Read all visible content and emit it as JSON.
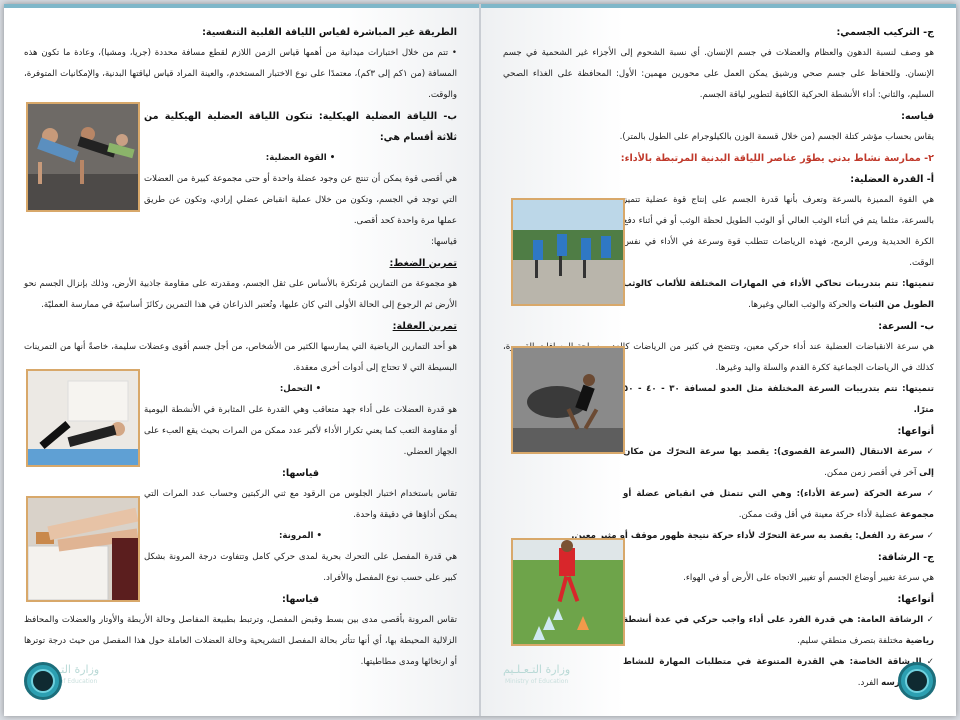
{
  "right_page": {
    "c_heading": "ج- التركيب الجسمي:",
    "c_p1": "هو وصف لنسبة الدهون والعظام والعضلات في جسم الإنسان. أي نسبة الشحوم إلى الأجزاء غير الشحمية في جسم الإنسان.",
    "c_p2": "وللحفاظ على جسم صحي ورشيق يمكن العمل على محورين مهمين: الأول: المحافظة على الغذاء الصحي السليم، والثاني: أداء",
    "c_p3": "الأنشطة الحركية الكافية لتطوير لياقة الجسم.",
    "measure_heading": "قياسه:",
    "measure_p": "يقاس بحساب مؤشر كتلة الجسم (من خلال قسمة الوزن بالكيلوجرام على الطول بالمتر).",
    "section2_heading": "٢- ممارسة نشاط بدني يطوّر عناصر اللياقة البدنية المرتبطة بالأداء:",
    "agility_power_heading": "أ- القدرة العضلية:",
    "power_p1": "هي القوة المميزة بالسرعة وتعرف بأنها قدرة الجسم على إنتاج قوة عضلية تتميز بالسرعة،",
    "power_p2": "مثلما يتم في أثناء الوثب العالي أو الوثب الطويل لحظة الوثب أو في أثناء دفع الكرة الحديدية",
    "power_p3": "ورمي الرمح، فهذه الرياضات تتطلب قوة وسرعة في الأداء في نفس الوقت.",
    "power_dev": "تنميتها: تتم بتدريبات تحاكي الأداء في المهارات المختلفة للألعاب كالوثب الطويل من الثبات",
    "power_dev2": "والحركة والوثب العالي وغيرها.",
    "speed_heading": "ب- السرعة:",
    "speed_p1": "هي سرعة الانقباضات العضلية عند أداء حركي معين، وتتضح في كثير من الرياضات كالعدو",
    "speed_p2": "وسباحة المسافات القصيرة، كذلك في الرياضات الجماعية ككرة القدم والسلة واليد وغيرها.",
    "speed_dev": "تنميتها: تتم بتدريبات السرعة المختلفة مثل العدو لمسافة ٣٠ - ٤٠ - ٥٠ مترًا.",
    "types_heading": "أنواعها:",
    "speed_t1a": "✓ سرعة الانتقال (السرعة القصوى): يقصد بها سرعة التحرّك من مكان إلى",
    "speed_t1b": "آخر في أقصر زمن ممكن.",
    "speed_t2a": "✓ سرعة الحركة (سرعة الأداء): وهي التي تتمثل في انقباض عضلة أو مجموعة",
    "speed_t2b": "عضلية لأداء حركة معينة في أقل وقت ممكن.",
    "speed_t3": "✓ سرعة رد الفعل: يقصد به سرعة التحرّك لأداء حركة نتيجة ظهور موقف أو مثير معين.",
    "agility_heading": "ج- الرشاقة:",
    "agility_p": "هي سرعة تغيير أوضاع الجسم أو تغيير الاتجاه على الأرض أو في الهواء.",
    "agility_types": "أنواعها:",
    "agility_t1a": "✓ الرشاقة العامة: هي قدرة الفرد على أداء واجب حركي في عدة أنشطة رياضية",
    "agility_t1b": "مختلفة بتصرف منطقي سليم.",
    "agility_t2a": "✓ الرشاقة الخاصة: هي القدرة المتنوعة في متطلبات المهارة للنشاط الذي يمارسه",
    "agility_t2b": "الفرد.",
    "watermark": "وزارة التـعـلـيم",
    "watermark_small": "Ministry of Education"
  },
  "left_page": {
    "indirect_heading": "الطريقة غير المباشرة لقياس اللياقة القلبية التنفسية:",
    "indirect_p1": "• تتم من خلال اختبارات ميدانية من أهمها قياس الزمن اللازم لقطع مسافة محددة (جريا، ومشيا)، وعادة ما تكون",
    "indirect_p2": "هذه المسافة (من ١كم إلى ٣كم)، معتمدًا على نوع الاختبار المستخدم، والعينة المراد قياس لياقتها البدنية، والإمكانيات",
    "indirect_p3": "المتوفرة، والوقت.",
    "structural_heading": "ب- اللياقة العضلية الهيكلية: تتكون اللياقة العضلية الهيكلية من ثلاثة أقسام هي:",
    "strength_bullet": "• القوة العضلية:",
    "strength_p1": "هي أقصى قوة يمكن أن تنتج عن وجود عضلة واحدة أو حتى مجموعة كبيرة من العضلات",
    "strength_p2": "التي توجد في الجسم، وتكون من خلال عملية انقباض عضلي إرادي، وتكون عن طريق عملها",
    "strength_p3": "مرة واحدة كحد أقصى.",
    "strength_measure": "قياسها:",
    "pushup_heading": "تمرين الضغط:",
    "pushup_p1": "هو مجموعة من التمارين مُرتكزة بالأساس على ثقل الجسم، ومقدرته على مقاومة جاذبية الأرض، وذلك بإنزال الجسم نحو",
    "pushup_p2": "الأرض ثم الرجوع إلى الحالة الأولى التي كان عليها، وتُعتبر الذراعان في هذا التمرين ركائزَ أساسيّة في ممارسة العمليّة.",
    "pullup_heading": "تمرين العقلة:",
    "pullup_p1": "هو أحد التمارين الرياضية التي يمارسها الكثير من الأشخاص، من أجل جسم أقوى وعضلات سليمة، خاصةً أنها من التمرينات",
    "pullup_p2": "البسيطة التي لا تحتاج إلى أدوات أخرى معقدة.",
    "endurance_bullet": "• التحمل:",
    "endurance_p1": "هو قدرة العضلات على أداء جهد متعاقب وهي القدرة على المثابرة في الأنشطة اليومية",
    "endurance_p2": "أو مقاومة التعب كما يعني تكرار الأداء لأكبر عدد ممكن من المرات بحيث يقع العبء على",
    "endurance_p3": "الجهاز العضلي.",
    "endurance_measure": "قياسها:",
    "endurance_m1": "تقاس باستخدام اختبار الجلوس من الرقود مع ثني الركبتين وحساب عدد المرات التي يمكن",
    "endurance_m2": "أداؤها في دقيقة واحدة.",
    "flex_bullet": "• المرونة:",
    "flex_p1": "هي قدرة المفصل على التحرك بحرية لمدى حركي كامل وتتفاوت درجة المرونة بشكل",
    "flex_p2": "كبير على حسب نوع المفصل والأفراد.",
    "flex_measure": "قياسها:",
    "flex_m1": "تقاس المرونة بأقصى مدى بين بسط وقبض المفصل، وترتبط بطبيعة المفاصل وحالة",
    "flex_m2": "الأربطة والأوتار والعضلات والمحافظ الزلالية المحيطة بها، أي أنها تتأثر بحالة المفصل التشريحية وحالة العضلات",
    "flex_m3": "العاملة حول هذا المفصل من حيث درجة توترها أو ارتخائها ومدى مطاطيتها.",
    "watermark": "وزارة التـعـلـيم",
    "watermark_small": "Ministry of Education"
  },
  "colors": {
    "accent": "#2c9fb1",
    "photo_border": "#d8a86a",
    "red_heading": "#c0392b"
  }
}
